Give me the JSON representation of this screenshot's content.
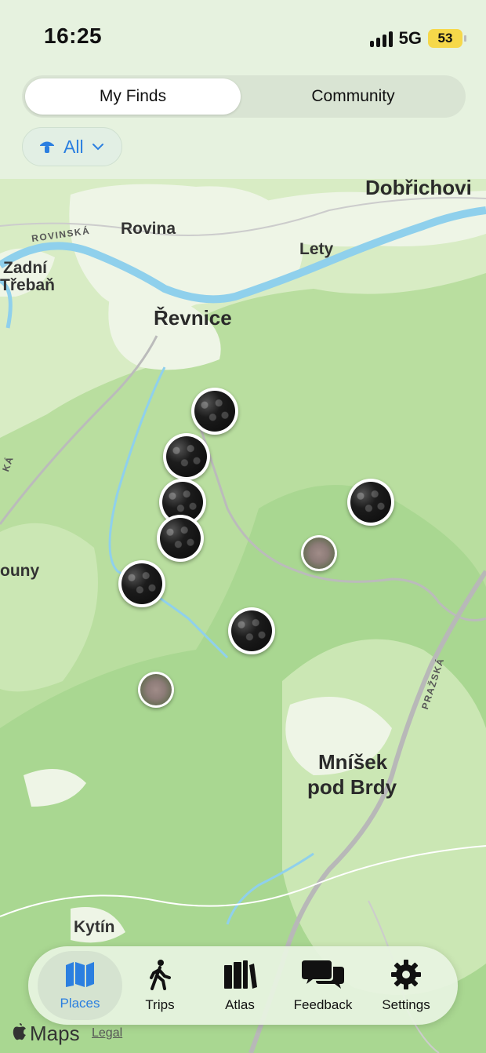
{
  "status_bar": {
    "time": "16:25",
    "network": "5G",
    "battery": "53"
  },
  "segmented_control": {
    "items": [
      "My Finds",
      "Community"
    ],
    "selected": "My Finds"
  },
  "filter": {
    "label": "All",
    "icon": "mushroom-icon"
  },
  "map": {
    "places": [
      {
        "name": "Dobřichovi",
        "kind": "city"
      },
      {
        "name": "Rovina",
        "kind": "town"
      },
      {
        "name": "ROVINSKÁ",
        "kind": "road"
      },
      {
        "name": "Lety",
        "kind": "town"
      },
      {
        "name": "Zadní",
        "kind": "town"
      },
      {
        "name": "Třebaň",
        "kind": "town"
      },
      {
        "name": "Řevnice",
        "kind": "city"
      },
      {
        "name": "KÁ",
        "kind": "road"
      },
      {
        "name": "ouny",
        "kind": "town"
      },
      {
        "name": "PRAŽSKÁ",
        "kind": "road"
      },
      {
        "name": "Mníšek",
        "kind": "city"
      },
      {
        "name": "pod Brdy",
        "kind": "city"
      },
      {
        "name": "Kytín",
        "kind": "town"
      }
    ],
    "pins": [
      {
        "type": "blackberry"
      },
      {
        "type": "blackberry"
      },
      {
        "type": "blackberry"
      },
      {
        "type": "blackberry"
      },
      {
        "type": "blackberry"
      },
      {
        "type": "blackberry"
      },
      {
        "type": "blackberry"
      },
      {
        "type": "moss"
      },
      {
        "type": "moss"
      }
    ]
  },
  "tab_bar": {
    "items": [
      {
        "label": "Places",
        "icon": "map-icon",
        "active": true
      },
      {
        "label": "Trips",
        "icon": "walking-person-icon",
        "active": false
      },
      {
        "label": "Atlas",
        "icon": "books-icon",
        "active": false
      },
      {
        "label": "Feedback",
        "icon": "chat-bubbles-icon",
        "active": false
      },
      {
        "label": "Settings",
        "icon": "gear-icon",
        "active": false
      }
    ]
  },
  "attribution": {
    "brand": "Maps",
    "legal": "Legal"
  },
  "colors": {
    "accent": "#2b7fe0",
    "forest": "#9fd08a",
    "water": "#8ed0ea"
  }
}
